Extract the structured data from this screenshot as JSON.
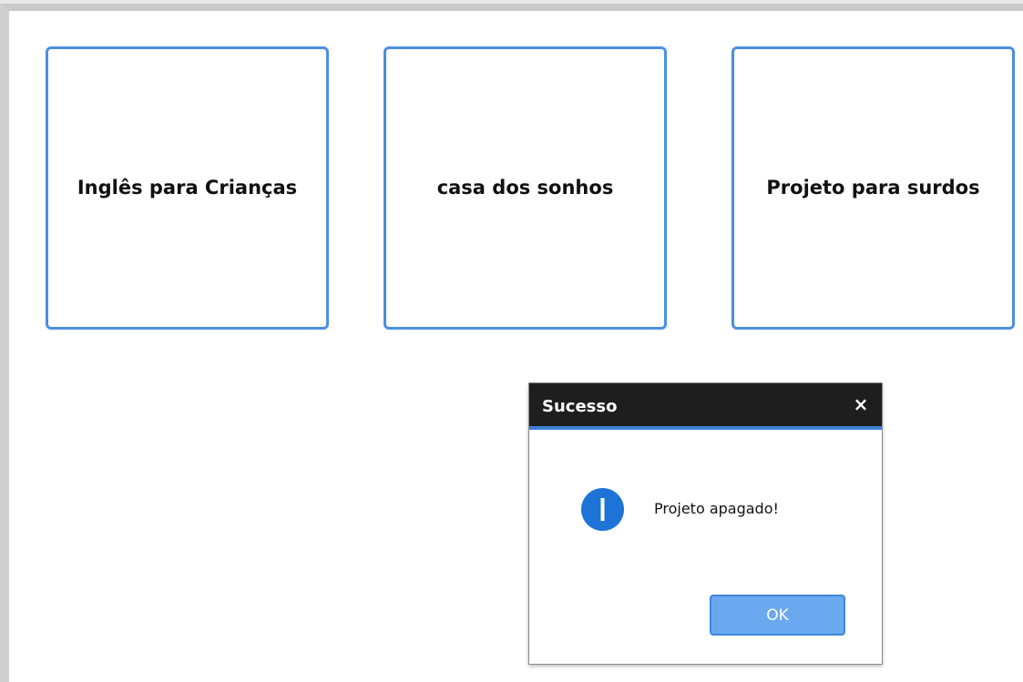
{
  "projects": [
    {
      "title": "Inglês para Crianças"
    },
    {
      "title": "casa dos sonhos"
    },
    {
      "title": "Projeto para surdos"
    }
  ],
  "dialog": {
    "title": "Sucesso",
    "close_symbol": "×",
    "icon": "info-icon",
    "message": "Projeto apagado!",
    "ok_label": "OK"
  },
  "colors": {
    "card_border": "#4a8fe2",
    "dialog_header": "#1e1e1e",
    "dialog_accent": "#3b82d6",
    "info_icon": "#1d73d6",
    "ok_button": "#6aa9f0"
  }
}
